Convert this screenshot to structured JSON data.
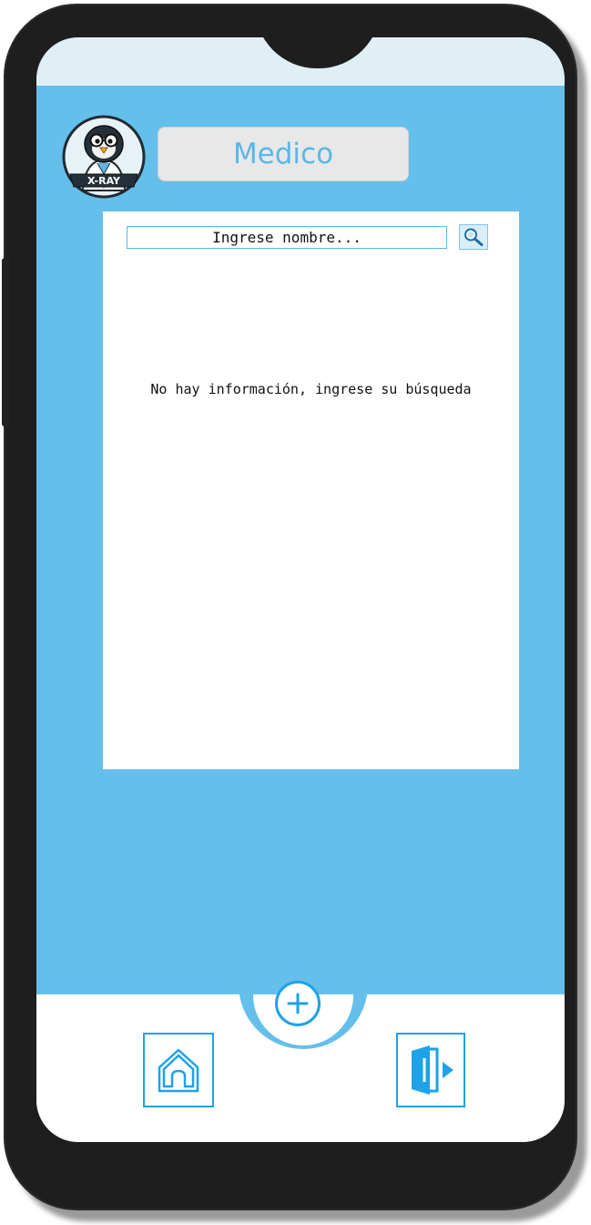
{
  "header": {
    "role_title": "Medico",
    "logo_label": "X-RAY"
  },
  "search": {
    "placeholder": "Ingrese nombre...",
    "button_icon": "magnifier-icon"
  },
  "results": {
    "empty_message": "No hay información, ingrese su búsqueda"
  },
  "bottom_nav": {
    "add_icon": "plus-circle-icon",
    "home_icon": "home-icon",
    "logout_icon": "logout-door-icon"
  },
  "colors": {
    "accent": "#1ea2e8",
    "screen_bg": "#64bfeb",
    "title_text": "#5ab7e8"
  }
}
